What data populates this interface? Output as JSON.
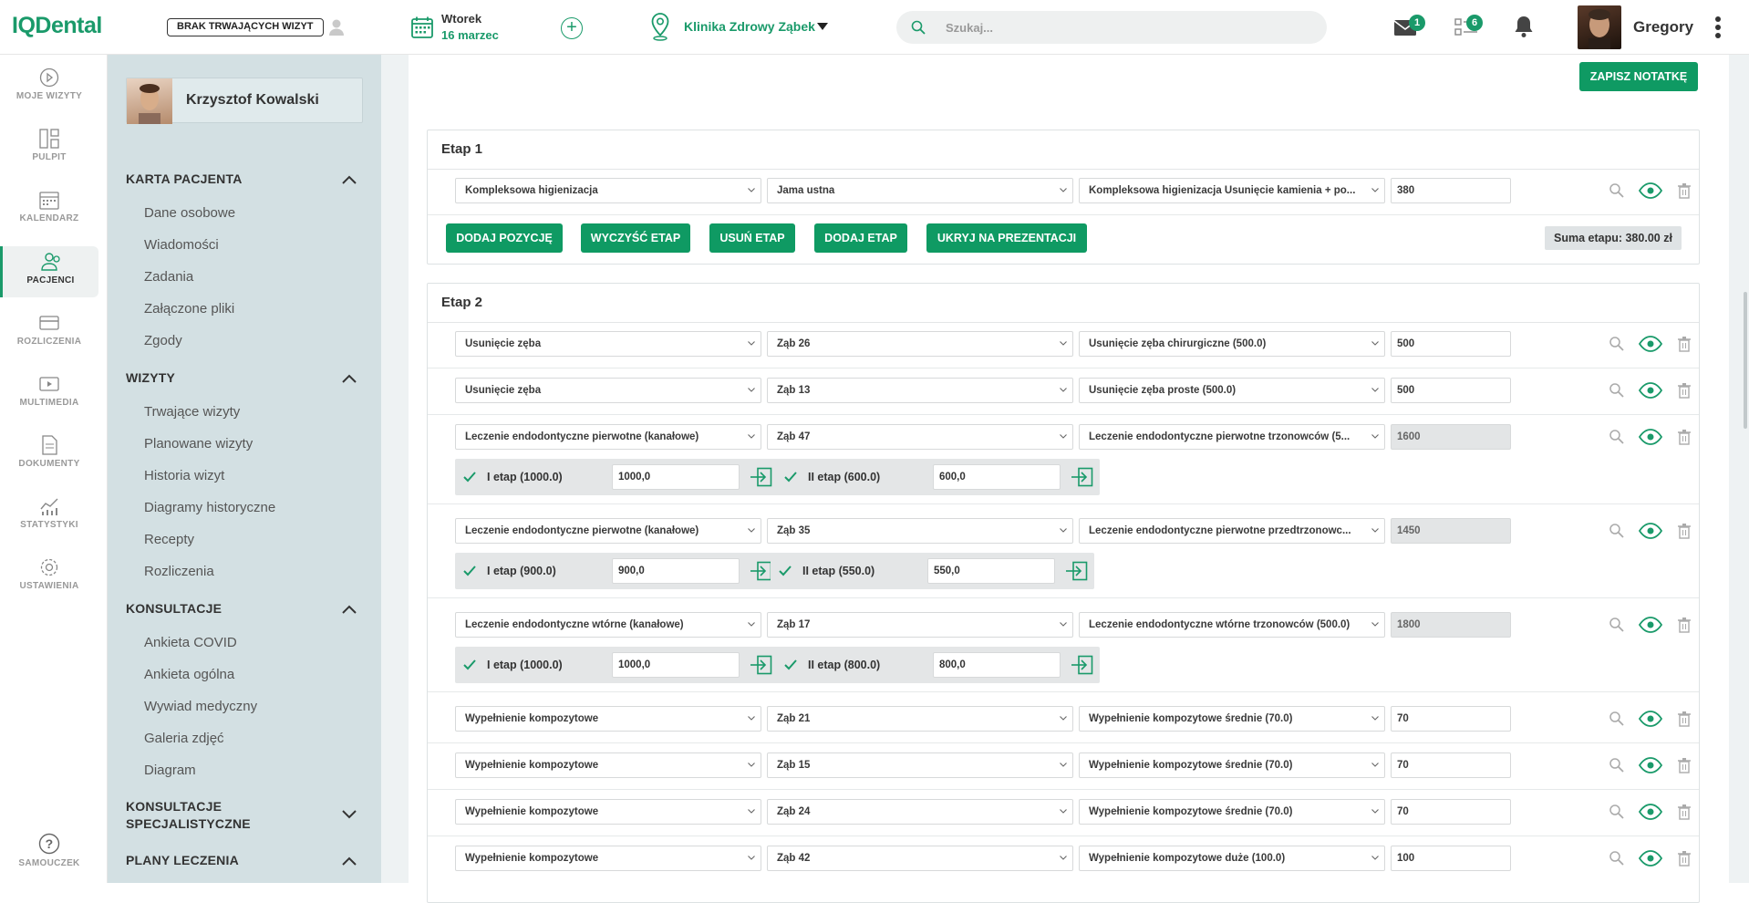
{
  "app": {
    "logo": "IQDental"
  },
  "topbar": {
    "no_visits_label": "BRAK TRWAJĄCYCH WIZYT",
    "day": "Wtorek",
    "date": "16 marzec",
    "clinic": "Klinika Zdrowy Ząbek",
    "search_placeholder": "Szukaj...",
    "mail_badge": "1",
    "tasks_badge": "6",
    "user_name": "Gregory"
  },
  "leftnav": {
    "items": [
      {
        "label": "MOJE WIZYTY",
        "icon": "play-circle-icon"
      },
      {
        "label": "PULPIT",
        "icon": "dashboard-icon"
      },
      {
        "label": "KALENDARZ",
        "icon": "calendar-icon"
      },
      {
        "label": "PACJENCI",
        "icon": "patients-icon"
      },
      {
        "label": "ROZLICZENIA",
        "icon": "card-icon"
      },
      {
        "label": "MULTIMEDIA",
        "icon": "media-icon"
      },
      {
        "label": "DOKUMENTY",
        "icon": "document-icon"
      },
      {
        "label": "STATYSTYKI",
        "icon": "stats-icon"
      },
      {
        "label": "USTAWIENIA",
        "icon": "gear-icon"
      }
    ],
    "help_label": "SAMOUCZEK",
    "active": "PACJENCI"
  },
  "patient": {
    "name": "Krzysztof Kowalski",
    "sections": [
      {
        "title": "KARTA PACJENTA",
        "links": [
          "Dane osobowe",
          "Wiadomości",
          "Zadania",
          "Załączone pliki",
          "Zgody"
        ]
      },
      {
        "title": "WIZYTY",
        "links": [
          "Trwające wizyty",
          "Planowane wizyty",
          "Historia wizyt",
          "Diagramy historyczne",
          "Recepty",
          "Rozliczenia"
        ]
      },
      {
        "title": "KONSULTACJE",
        "links": [
          "Ankieta COVID",
          "Ankieta ogólna",
          "Wywiad medyczny",
          "Galeria zdjęć",
          "Diagram"
        ]
      },
      {
        "title_line1": "KONSULTACJE",
        "title_line2": "SPECJALISTYCZNE"
      },
      {
        "title": "PLANY LECZENIA"
      }
    ]
  },
  "main": {
    "save_note": "ZAPISZ NOTATKĘ",
    "stage1": {
      "title": "Etap 1",
      "row": {
        "procedure": "Kompleksowa higienizacja",
        "tooth": "Jama ustna",
        "detail": "Kompleksowa higienizacja Usunięcie kamienia + po...",
        "price": "380"
      },
      "buttons": [
        "DODAJ POZYCJĘ",
        "WYCZYŚĆ ETAP",
        "USUŃ ETAP",
        "DODAJ ETAP",
        "UKRYJ NA PREZENTACJI"
      ],
      "sum": "Suma etapu: 380.00 zł"
    },
    "stage2": {
      "title": "Etap 2",
      "rows": [
        {
          "procedure": "Usunięcie zęba",
          "tooth": "Ząb 26",
          "detail": "Usunięcie zęba chirurgiczne (500.0)",
          "price": "500"
        },
        {
          "procedure": "Usunięcie zęba",
          "tooth": "Ząb 13",
          "detail": "Usunięcie zęba proste (500.0)",
          "price": "500"
        },
        {
          "procedure": "Leczenie endodontyczne pierwotne (kanałowe)",
          "tooth": "Ząb 47",
          "detail": "Leczenie endodontyczne pierwotne trzonowców (5...",
          "price": "1600",
          "sub": [
            {
              "label": "I etap (1000.0)",
              "value": "1000,0"
            },
            {
              "label": "II etap (600.0)",
              "value": "600,0"
            }
          ]
        },
        {
          "procedure": "Leczenie endodontyczne pierwotne (kanałowe)",
          "tooth": "Ząb 35",
          "detail": "Leczenie endodontyczne pierwotne przedtrzonowc...",
          "price": "1450",
          "sub": [
            {
              "label": "I etap (900.0)",
              "value": "900,0"
            },
            {
              "label": "II etap (550.0)",
              "value": "550,0"
            }
          ]
        },
        {
          "procedure": "Leczenie endodontyczne wtórne (kanałowe)",
          "tooth": "Ząb 17",
          "detail": "Leczenie endodontyczne wtórne trzonowców (500.0)",
          "price": "1800",
          "sub": [
            {
              "label": "I etap (1000.0)",
              "value": "1000,0"
            },
            {
              "label": "II etap (800.0)",
              "value": "800,0"
            }
          ]
        },
        {
          "procedure": "Wypełnienie kompozytowe",
          "tooth": "Ząb 21",
          "detail": "Wypełnienie kompozytowe średnie (70.0)",
          "price": "70"
        },
        {
          "procedure": "Wypełnienie kompozytowe",
          "tooth": "Ząb 15",
          "detail": "Wypełnienie kompozytowe średnie (70.0)",
          "price": "70"
        },
        {
          "procedure": "Wypełnienie kompozytowe",
          "tooth": "Ząb 24",
          "detail": "Wypełnienie kompozytowe średnie (70.0)",
          "price": "70"
        },
        {
          "procedure": "Wypełnienie kompozytowe",
          "tooth": "Ząb 42",
          "detail": "Wypełnienie kompozytowe duże (100.0)",
          "price": "100"
        }
      ]
    }
  },
  "colors": {
    "accent": "#0f9a63",
    "sidebar": "#d3e0e3",
    "background": "#eef2f3"
  }
}
